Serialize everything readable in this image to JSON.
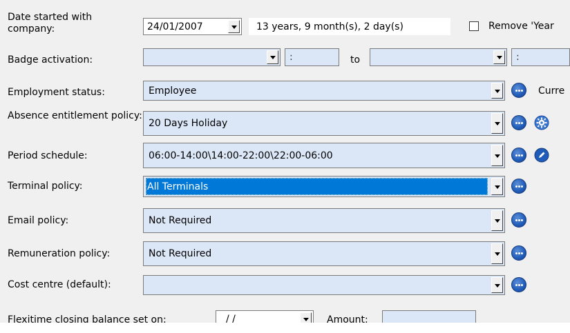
{
  "rows": {
    "date_started": {
      "label": "Date started with company:",
      "date_value": "24/01/2007",
      "duration": "13 years, 9 month(s), 2 day(s)",
      "checkbox_label": "Remove 'Year"
    },
    "badge_activation": {
      "label": "Badge activation:",
      "from_date": "",
      "from_time": ":",
      "to_label": "to",
      "to_date": "",
      "to_time": ":"
    },
    "employment_status": {
      "label": "Employment status:",
      "value": "Employee",
      "trailing_text": "Curre"
    },
    "absence_policy": {
      "label": "Absence entitlement policy:",
      "value": "20 Days Holiday"
    },
    "period_schedule": {
      "label": "Period schedule:",
      "value": "06:00-14:00\\14:00-22:00\\22:00-06:00"
    },
    "terminal_policy": {
      "label": "Terminal policy:",
      "value": "All Terminals"
    },
    "email_policy": {
      "label": "Email policy:",
      "value": "Not Required"
    },
    "remuneration_policy": {
      "label": "Remuneration policy:",
      "value": "Not Required"
    },
    "cost_centre": {
      "label": "Cost centre (default):",
      "value": ""
    },
    "flexitime": {
      "label": "Flexitime closing balance set on:",
      "date_value": "/ /",
      "amount_label": "Amount:",
      "amount_value": ""
    }
  },
  "colors": {
    "field_bg": "#dbe7f7",
    "selection": "#0078d7",
    "panel_bg": "#f0f0f0",
    "icon_blue": "#1f5bb8"
  },
  "icons": [
    "ellipsis-icon",
    "gear-icon",
    "edit-pencil-icon",
    "dropdown-arrow-icon"
  ]
}
